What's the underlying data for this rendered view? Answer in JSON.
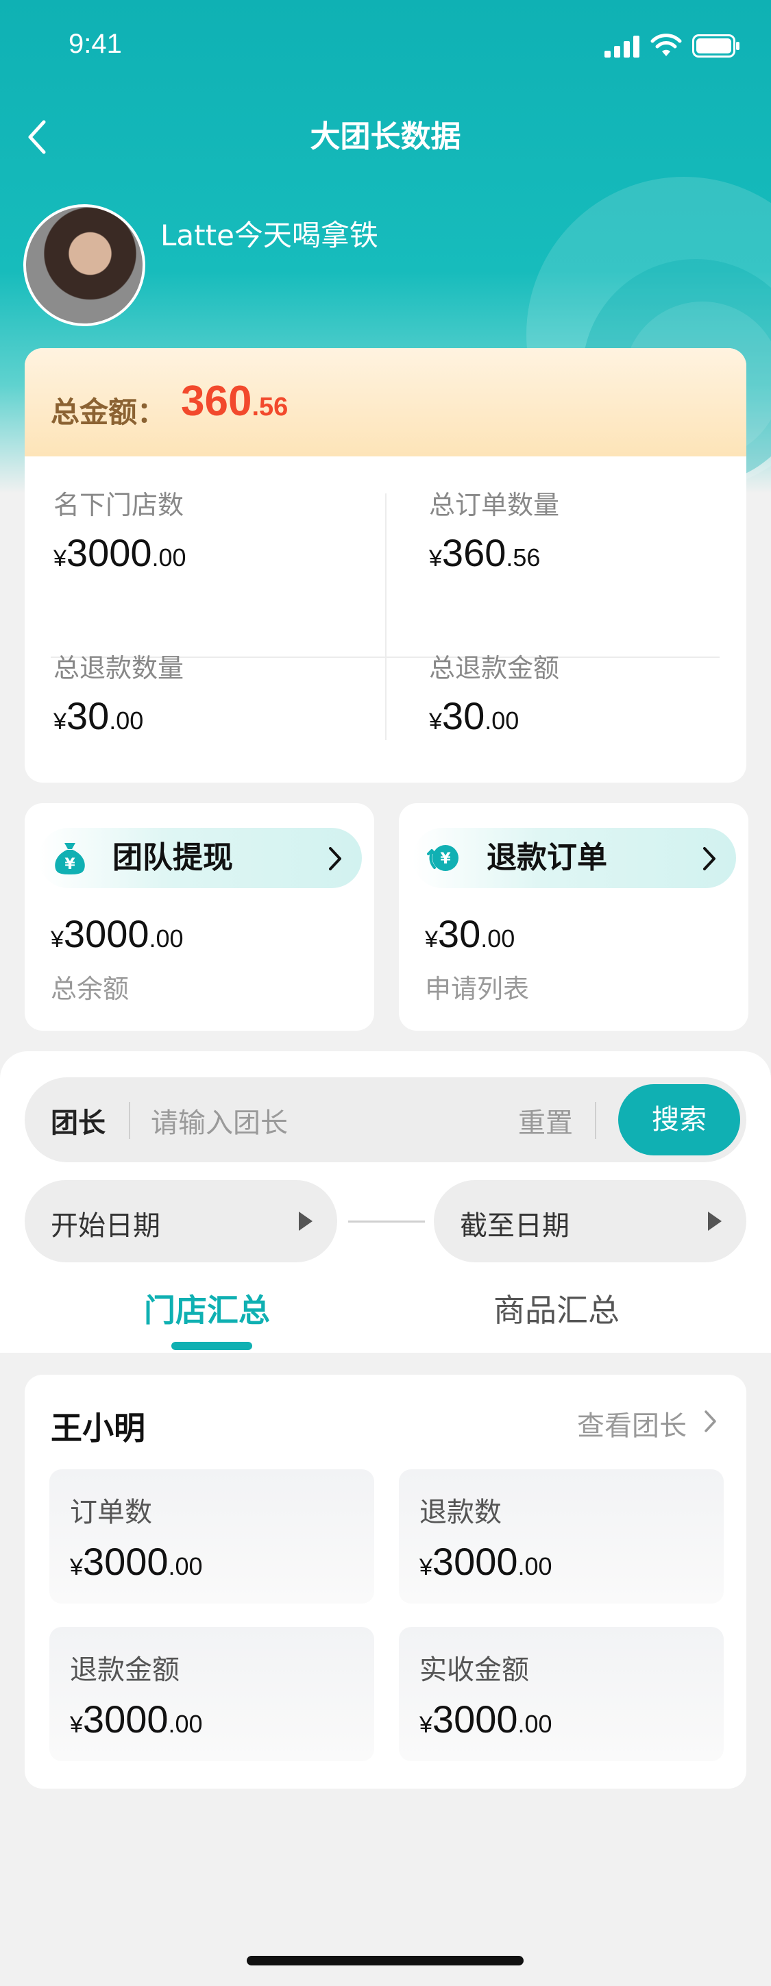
{
  "status_bar": {
    "time": "9:41"
  },
  "nav": {
    "title": "大团长数据"
  },
  "profile": {
    "username": "Latte今天喝拿铁"
  },
  "summary": {
    "total_label": "总金额：",
    "total_int": "360",
    "total_dec": ".56",
    "stats": [
      {
        "label": "名下门店数",
        "currency": "¥",
        "int": "3000",
        "dec": ".00"
      },
      {
        "label": "总订单数量",
        "currency": "¥",
        "int": "360",
        "dec": ".56"
      },
      {
        "label": "总退款数量",
        "currency": "¥",
        "int": "30",
        "dec": ".00"
      },
      {
        "label": "总退款金额",
        "currency": "¥",
        "int": "30",
        "dec": ".00"
      }
    ]
  },
  "actions": [
    {
      "title": "团队提现",
      "icon": "money-bag-icon",
      "currency": "¥",
      "int": "3000",
      "dec": ".00",
      "sub": "总余额"
    },
    {
      "title": "退款订单",
      "icon": "refund-icon",
      "currency": "¥",
      "int": "30",
      "dec": ".00",
      "sub": "申请列表"
    }
  ],
  "filter": {
    "search_tag": "团长",
    "search_placeholder": "请输入团长",
    "reset_label": "重置",
    "search_button": "搜索",
    "start_date": "开始日期",
    "end_date": "截至日期"
  },
  "tabs": [
    {
      "label": "门店汇总",
      "active": true
    },
    {
      "label": "商品汇总",
      "active": false
    }
  ],
  "leader": {
    "name": "王小明",
    "view_link": "查看团长",
    "stats": [
      {
        "label": "订单数",
        "currency": "¥",
        "int": "3000",
        "dec": ".00"
      },
      {
        "label": "退款数",
        "currency": "¥",
        "int": "3000",
        "dec": ".00"
      },
      {
        "label": "退款金额",
        "currency": "¥",
        "int": "3000",
        "dec": ".00"
      },
      {
        "label": "实收金额",
        "currency": "¥",
        "int": "3000",
        "dec": ".00"
      }
    ]
  },
  "colors": {
    "accent": "#10b0b3",
    "total_value": "#f2492c",
    "total_label": "#8b6232"
  }
}
